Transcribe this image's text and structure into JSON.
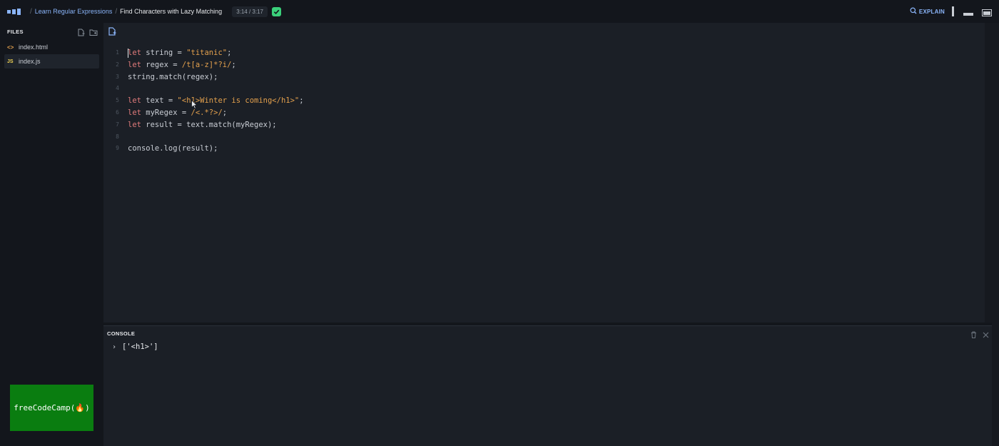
{
  "header": {
    "breadcrumb_course": "Learn Regular Expressions",
    "breadcrumb_lesson": "Find Characters with Lazy Matching",
    "breadcrumb_separator": "/",
    "timer": "3:14 / 3:17",
    "explain_label": "EXPLAIN",
    "accent_color": "#8ab4f8",
    "complete_color": "#3ad07a"
  },
  "sidebar": {
    "files_title": "FILES",
    "files": [
      {
        "name": "index.html",
        "icon": "html-icon",
        "ext_label": "<>"
      },
      {
        "name": "index.js",
        "icon": "js-icon",
        "ext_label": "JS",
        "active": true
      }
    ],
    "badge_text": "freeCodeCamp(🔥)",
    "badge_color": "#0a7d10"
  },
  "editor": {
    "lines": [
      {
        "n": "1",
        "tokens": [
          [
            "kw",
            "let"
          ],
          [
            "p",
            " string = "
          ],
          [
            "str",
            "\"titanic\""
          ],
          [
            "p",
            ";"
          ]
        ]
      },
      {
        "n": "2",
        "tokens": [
          [
            "kw",
            "let"
          ],
          [
            "p",
            " regex = "
          ],
          [
            "rgx",
            "/t[a-z]*?i/"
          ],
          [
            "p",
            ";"
          ]
        ]
      },
      {
        "n": "3",
        "tokens": [
          [
            "p",
            "string.match(regex);"
          ]
        ]
      },
      {
        "n": "4",
        "tokens": []
      },
      {
        "n": "5",
        "tokens": [
          [
            "kw",
            "let"
          ],
          [
            "p",
            " text = "
          ],
          [
            "str",
            "\"<h1>Winter is coming</h1>\""
          ],
          [
            "p",
            ";"
          ]
        ]
      },
      {
        "n": "6",
        "tokens": [
          [
            "kw",
            "let"
          ],
          [
            "p",
            " myRegex = "
          ],
          [
            "rgx",
            "/<.*?>/"
          ],
          [
            "p",
            ";"
          ]
        ]
      },
      {
        "n": "7",
        "tokens": [
          [
            "kw",
            "let"
          ],
          [
            "p",
            " result = text.match(myRegex);"
          ]
        ]
      },
      {
        "n": "8",
        "tokens": []
      },
      {
        "n": "9",
        "tokens": [
          [
            "p",
            "console.log(result);"
          ]
        ]
      }
    ]
  },
  "console": {
    "title": "CONSOLE",
    "output": "['<h1>']"
  }
}
